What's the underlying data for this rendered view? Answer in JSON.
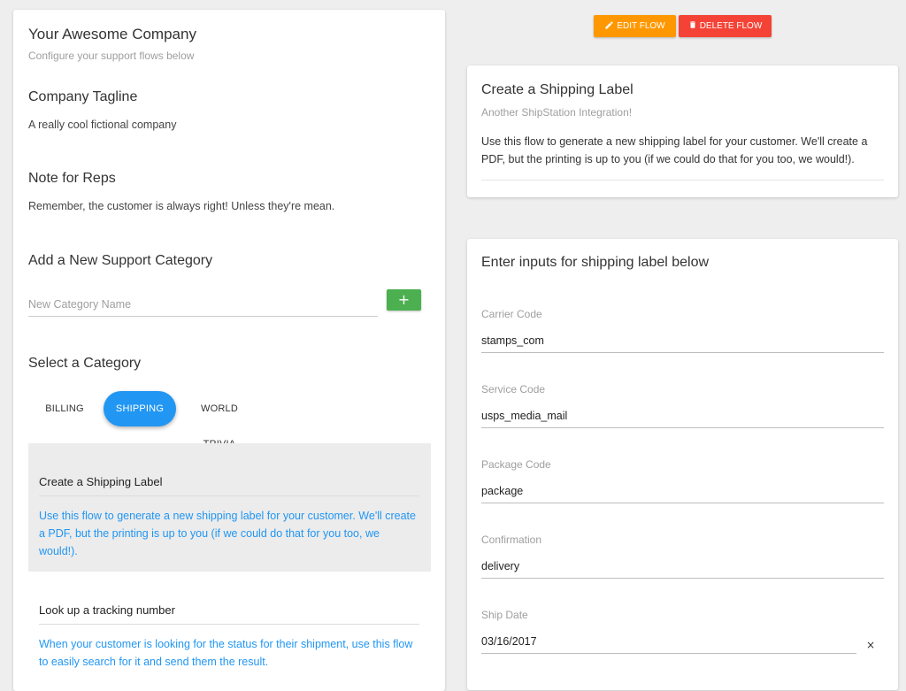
{
  "company": {
    "name": "Your Awesome Company",
    "subtitle": "Configure your support flows below"
  },
  "tagline": {
    "title": "Company Tagline",
    "text": "A really cool fictional company"
  },
  "note": {
    "title": "Note for Reps",
    "text": "Remember, the customer is always right! Unless they're mean."
  },
  "add_category": {
    "title": "Add a New Support Category",
    "placeholder": "New Category Name",
    "value": "",
    "add_label": "+"
  },
  "select_category": {
    "title": "Select a Category",
    "tabs": [
      {
        "label": "BILLING",
        "active": false
      },
      {
        "label": "SHIPPING",
        "active": true
      },
      {
        "label": "WORLD TRIVIA",
        "active": false
      }
    ]
  },
  "flows": [
    {
      "title": "Create a Shipping Label",
      "description": "Use this flow to generate a new shipping label for your customer. We'll create a PDF, but the printing is up to you (if we could do that for you too, we would!).",
      "selected": true
    },
    {
      "title": "Look up a tracking number",
      "description": "When your customer is looking for the status for their shipment, use this flow to easily search for it and send them the result.",
      "selected": false
    }
  ],
  "toolbar": {
    "edit_label": "EDIT FLOW",
    "delete_label": "DELETE FLOW",
    "edit_icon": "pencil-icon",
    "delete_icon": "trash-icon"
  },
  "flow_detail": {
    "title": "Create a Shipping Label",
    "subtitle": "Another ShipStation Integration!",
    "description": "Use this flow to generate a new shipping label for your customer. We'll create a PDF, but the printing is up to you (if we could do that for you too, we would!)."
  },
  "inputs_form": {
    "title": "Enter inputs for shipping label below",
    "fields": [
      {
        "label": "Carrier Code",
        "value": "stamps_com"
      },
      {
        "label": "Service Code",
        "value": "usps_media_mail"
      },
      {
        "label": "Package Code",
        "value": "package"
      },
      {
        "label": "Confirmation",
        "value": "delivery"
      },
      {
        "label": "Ship Date",
        "value": "03/16/2017"
      }
    ],
    "clear_label": "×"
  },
  "colors": {
    "accent": "#2196f3",
    "edit": "#ff9800",
    "delete": "#f44336",
    "add": "#4caf50",
    "background": "#eeeeee"
  }
}
